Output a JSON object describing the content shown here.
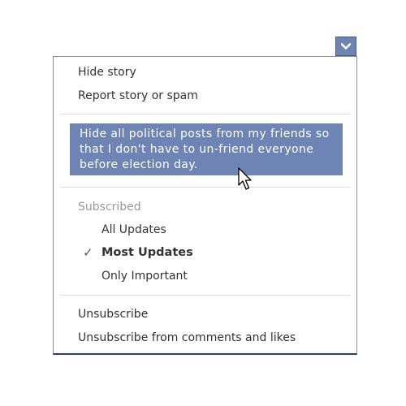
{
  "menu_toggle": {
    "icon": "chevron-down-icon"
  },
  "menu": {
    "hide_story": "Hide story",
    "report_story": "Report story or spam",
    "highlighted_item": {
      "line1": "Hide all political posts from my friends so",
      "line2": "that I don't have to un-friend everyone",
      "line3": "before election day."
    },
    "subscribed_header": "Subscribed",
    "subscribed_options": {
      "all_updates": "All Updates",
      "most_updates": "Most Updates",
      "only_important": "Only Important"
    },
    "selected_option": "Most Updates",
    "check_icon": "checkmark-icon",
    "unsubscribe": "Unsubscribe",
    "unsubscribe_comments": "Unsubscribe from comments and likes"
  },
  "colors": {
    "accent": "#6d84b4",
    "accent_border": "#3b5998",
    "text": "#333333",
    "muted": "#999999"
  }
}
